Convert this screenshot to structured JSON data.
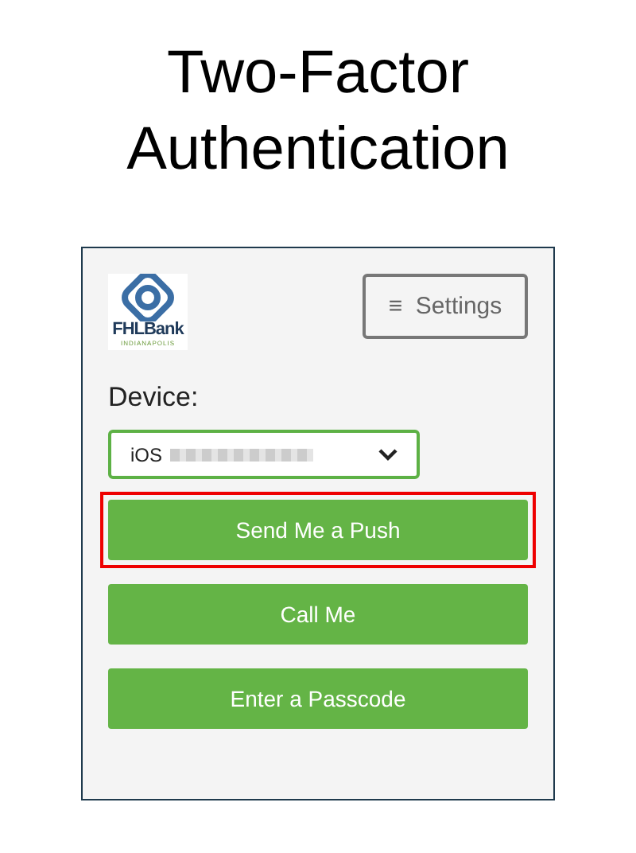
{
  "title": "Two-Factor Authentication",
  "logo": {
    "name": "FHLBank",
    "subtitle": "INDIANAPOLIS"
  },
  "settings_button": {
    "icon": "≡",
    "label": "Settings"
  },
  "device": {
    "label": "Device:",
    "value": "iOS"
  },
  "buttons": [
    {
      "label": "Send Me a Push",
      "highlighted": true
    },
    {
      "label": "Call Me",
      "highlighted": false
    },
    {
      "label": "Enter a Passcode",
      "highlighted": false
    }
  ]
}
